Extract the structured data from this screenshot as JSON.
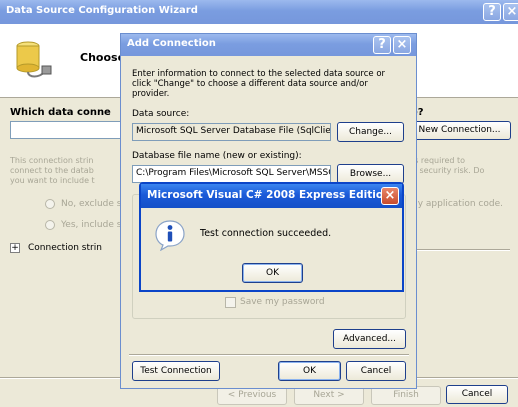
{
  "wizard": {
    "title": "Data Source Configuration Wizard",
    "header": "Choose",
    "question_left": "Which data conne",
    "question_right": "se?",
    "new_connection_label": "New Connection...",
    "desc_left_1": "This connection strin",
    "desc_left_2": "connect to the datab",
    "desc_left_3": "you want to include t",
    "desc_right_1": "is required to",
    "desc_right_2": "a security risk. Do",
    "radio_no": "No, exclude s",
    "radio_no_right": "ny application code.",
    "radio_yes": "Yes, include s",
    "expander": "Connection strin",
    "previous_label": "< Previous",
    "next_label": "Next >",
    "finish_label": "Finish",
    "cancel_label": "Cancel"
  },
  "add_connection": {
    "title": "Add Connection",
    "intro": "Enter information to connect to the selected data source or click \"Change\" to choose a different data source and/or provider.",
    "data_source_label": "Data source:",
    "data_source_value": "Microsoft SQL Server Database File (SqlClien",
    "change_label": "Change...",
    "db_file_label": "Database file name (new or existing):",
    "db_file_value": "C:\\Program Files\\Microsoft SQL Server\\MSSC",
    "browse_label": "Browse...",
    "save_password_label": "Save my password",
    "advanced_label": "Advanced...",
    "test_connection_label": "Test Connection",
    "ok_label": "OK",
    "cancel_label": "Cancel"
  },
  "message_box": {
    "title": "Microsoft Visual C# 2008 Express Edition",
    "message": "Test connection succeeded.",
    "ok_label": "OK",
    "icon": "info-icon"
  },
  "colors": {
    "titlebar_active": "#1b5ad8",
    "titlebar_inactive": "#7a9de0",
    "dialog_bg": "#ece9d8",
    "close_red": "#c94c2c"
  }
}
